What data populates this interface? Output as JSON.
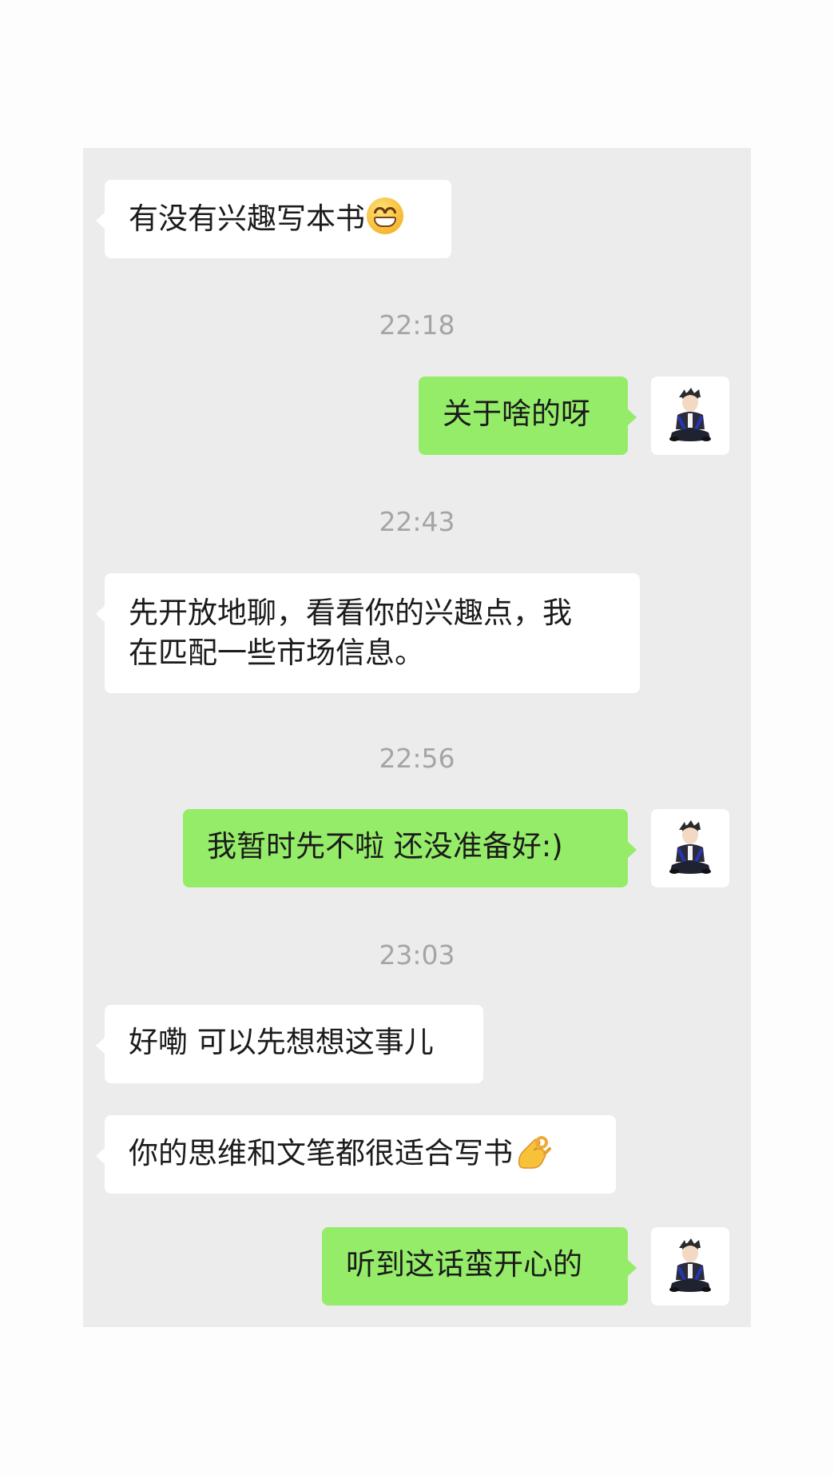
{
  "messages": [
    {
      "type": "in",
      "text": "有没有兴趣写本书",
      "emoji": "grinning-face-icon"
    },
    {
      "type": "time",
      "text": "22:18"
    },
    {
      "type": "out",
      "text": "关于啥的呀"
    },
    {
      "type": "time",
      "text": "22:43"
    },
    {
      "type": "in",
      "lines": [
        "先开放地聊，看看你的兴趣点，我",
        "在匹配一些市场信息。"
      ]
    },
    {
      "type": "time",
      "text": "22:56"
    },
    {
      "type": "out",
      "text": "我暂时先不啦 还没准备好:)"
    },
    {
      "type": "time",
      "text": "23:03"
    },
    {
      "type": "in",
      "text": "好嘞 可以先想想这事儿"
    },
    {
      "type": "in",
      "text": "你的思维和文笔都很适合写书",
      "emoji": "ok-hand-icon"
    },
    {
      "type": "out",
      "text": "听到这话蛮开心的"
    }
  ],
  "colors": {
    "chat_background": "#ececec",
    "incoming_bubble": "#ffffff",
    "outgoing_bubble": "#95ec69",
    "timestamp_text": "#a5a5a5",
    "message_text": "#1b1b1b"
  },
  "avatar": {
    "icon": "user-avatar-icon"
  }
}
